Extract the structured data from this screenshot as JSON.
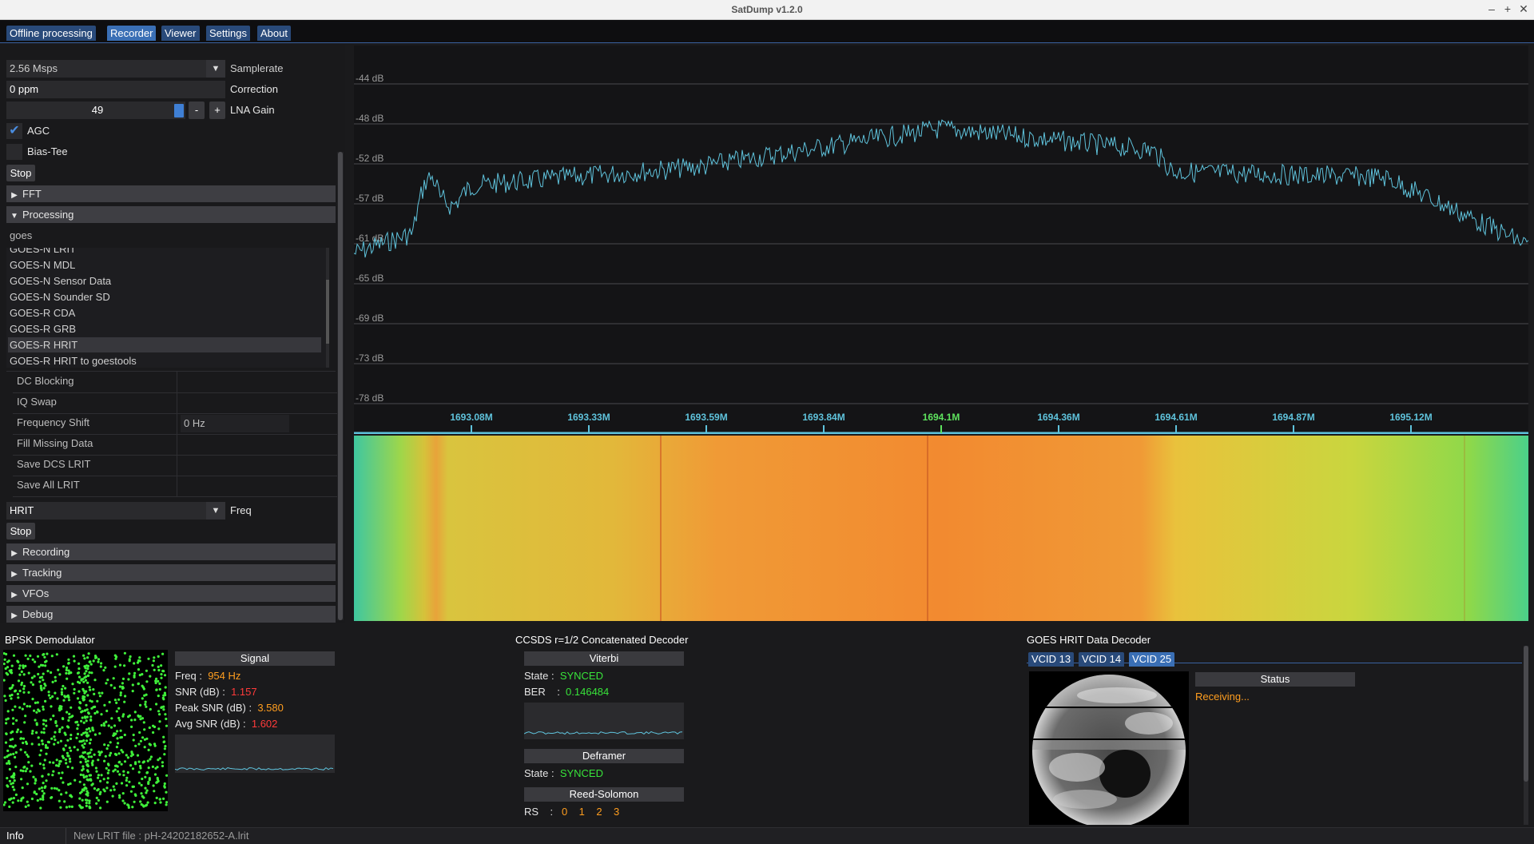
{
  "window": {
    "title": "SatDump v1.2.0"
  },
  "tabs": [
    {
      "label": "Offline processing"
    },
    {
      "label": "Recorder"
    },
    {
      "label": "Viewer"
    },
    {
      "label": "Settings"
    },
    {
      "label": "About"
    }
  ],
  "source": {
    "samplerate_value": "2.56 Msps",
    "samplerate_label": "Samplerate",
    "correction_value": "0 ppm",
    "correction_label": "Correction",
    "lna_value": "49",
    "lna_label": "LNA Gain",
    "minus": "-",
    "plus": "+",
    "agc_label": "AGC",
    "agc_checked": true,
    "biastee_label": "Bias-Tee",
    "stop_label": "Stop"
  },
  "sections": {
    "fft": "FFT",
    "processing": "Processing",
    "recording": "Recording",
    "tracking": "Tracking",
    "vfos": "VFOs",
    "debug": "Debug"
  },
  "processing": {
    "search_value": "goes",
    "pipelines": [
      "GOES-N LRIT",
      "GOES-N MDL",
      "GOES-N Sensor Data",
      "GOES-N Sounder SD",
      "GOES-R CDA",
      "GOES-R GRB",
      "GOES-R HRIT",
      "GOES-R HRIT to goestools"
    ],
    "selected_index": 6,
    "options": [
      {
        "label": "DC Blocking",
        "value": ""
      },
      {
        "label": "IQ Swap",
        "value": ""
      },
      {
        "label": "Frequency Shift",
        "value": "0 Hz"
      },
      {
        "label": "Fill Missing Data",
        "value": ""
      },
      {
        "label": "Save DCS LRIT",
        "value": ""
      },
      {
        "label": "Save All LRIT",
        "value": ""
      }
    ],
    "mode_value": "HRIT",
    "mode_label": "Freq",
    "stop_label": "Stop"
  },
  "spectrum": {
    "db_labels": [
      "-44 dB",
      "-48 dB",
      "-52 dB",
      "-57 dB",
      "-61 dB",
      "-65 dB",
      "-69 dB",
      "-73 dB",
      "-78 dB"
    ],
    "freq_labels": [
      "1693.08M",
      "1693.33M",
      "1693.59M",
      "1693.84M",
      "1694.1M",
      "1694.36M",
      "1694.61M",
      "1694.87M",
      "1695.12M"
    ],
    "center_index": 4,
    "trace_color": "#5fc3dc",
    "center_color": "#5ee35e"
  },
  "demod": {
    "title": "BPSK Demodulator",
    "signal_header": "Signal",
    "freq_label": "Freq :",
    "freq_value": "954 Hz",
    "snr_label": "SNR (dB) :",
    "snr_value": "1.157",
    "peak_label": "Peak SNR (dB) :",
    "peak_value": "3.580",
    "avg_label": "Avg SNR (dB) :",
    "avg_value": "1.602"
  },
  "ccsds": {
    "title": "CCSDS r=1/2 Concatenated Decoder",
    "viterbi_header": "Viterbi",
    "state_label": "State :",
    "viterbi_state": "SYNCED",
    "ber_label": "BER",
    "ber_sep": ":",
    "ber_value": "0.146484",
    "deframer_header": "Deframer",
    "deframer_state": "SYNCED",
    "rs_header": "Reed-Solomon",
    "rs_label": "RS",
    "rs_sep": ":",
    "rs_values": [
      "0",
      "1",
      "2",
      "3"
    ]
  },
  "hrit": {
    "title": "GOES HRIT Data Decoder",
    "vcid_tabs": [
      "VCID 13",
      "VCID 14",
      "VCID 25"
    ],
    "status_header": "Status",
    "status_value": "Receiving..."
  },
  "statusbar": {
    "level": "Info",
    "message": "New LRIT file : pH-24202182652-A.lrit"
  }
}
